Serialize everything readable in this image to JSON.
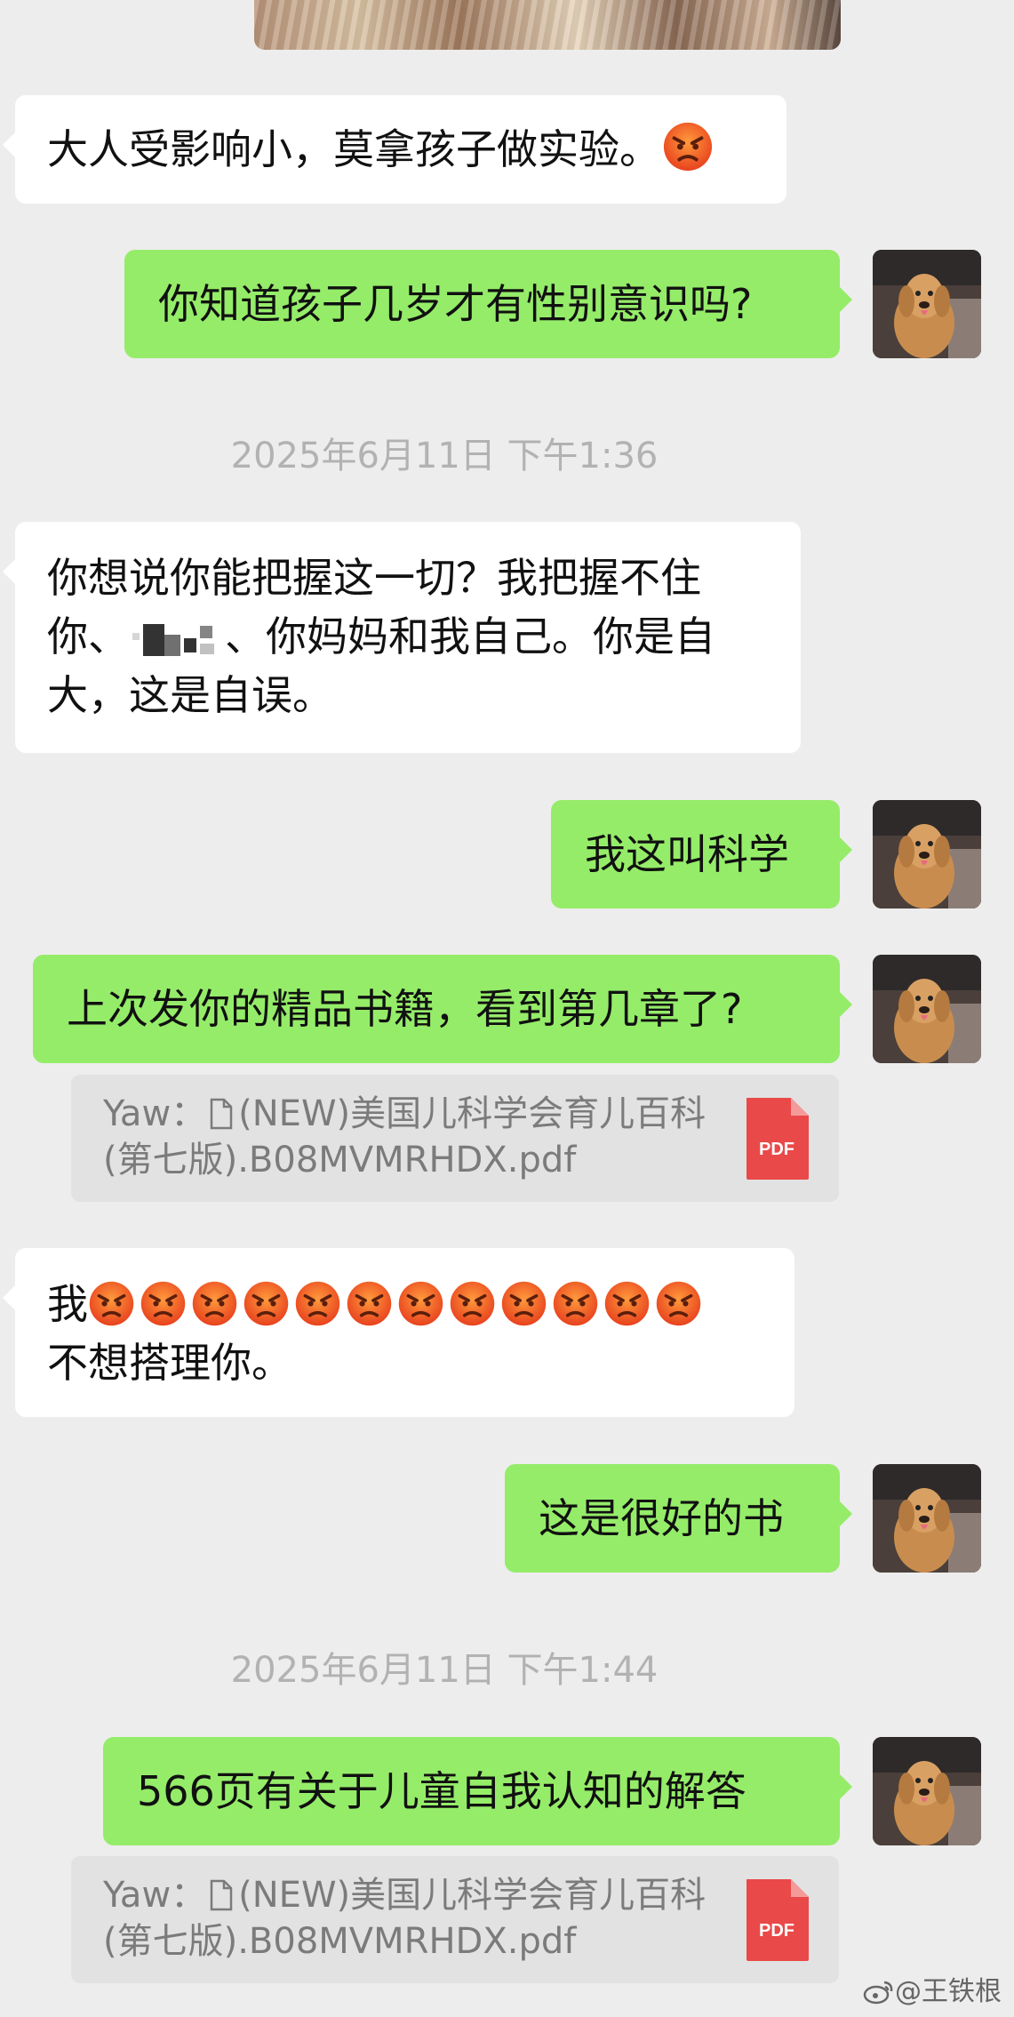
{
  "messages": {
    "m1": {
      "text": "大人受影响小，莫拿孩子做实验。"
    },
    "m2": {
      "text": "你知道孩子几岁才有性别意识吗?"
    },
    "m3": {
      "line1": "你想说你能把握这一切？我把握不住",
      "line2a": "你、",
      "line2b": "、你妈妈和我自己。你是自",
      "line3": "大，这是自误。"
    },
    "m4": {
      "text": "我这叫科学"
    },
    "m5": {
      "text": "上次发你的精品书籍，看到第几章了?"
    },
    "m6": {
      "line1_prefix": "我",
      "line2": "不想搭理你。"
    },
    "m7": {
      "text": "这是很好的书"
    },
    "m8": {
      "text": "566页有关于儿童自我认知的解答"
    }
  },
  "timestamps": [
    "2025年6月11日 下午1:36",
    "2025年6月11日 下午1:44"
  ],
  "quotes": [
    {
      "sender": "Yaw：",
      "line1": "(NEW)美国儿科学会育儿百科",
      "line2": "(第七版).B08MVMRHDX.pdf",
      "badge": "PDF"
    },
    {
      "sender": "Yaw：",
      "line1": "(NEW)美国儿科学会育儿百科",
      "line2": "(第七版).B08MVMRHDX.pdf",
      "badge": "PDF"
    }
  ],
  "icons": {
    "angry": "angry-face-emoji",
    "file": "document-icon",
    "pdf": "pdf-file-icon",
    "weibo": "weibo-logo"
  },
  "colors": {
    "bg": "#ededed",
    "mine": "#95ec69",
    "theirs": "#ffffff",
    "pdf": "#e94948"
  },
  "watermark": "@王铁根"
}
